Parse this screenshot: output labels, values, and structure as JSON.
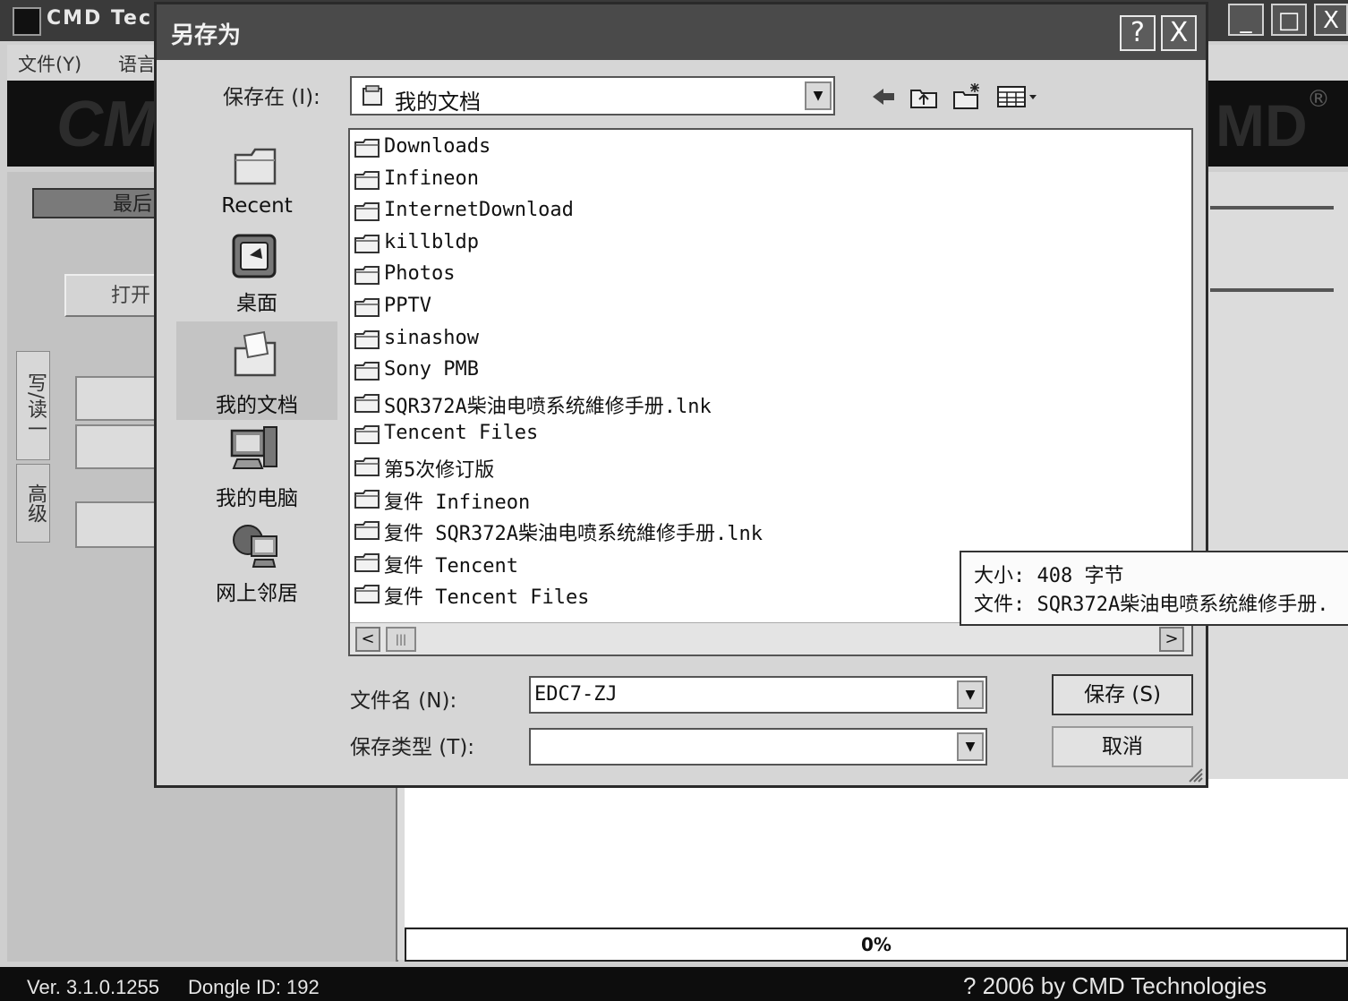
{
  "app": {
    "title": "CMD Tec",
    "menu": [
      "文件(Y)",
      "语言"
    ],
    "banner_left": "CM",
    "banner_right": "MD",
    "banner_reg": "®",
    "btn_recent": "最后",
    "btn_open": "打开",
    "side_tabs": [
      "写/读一",
      "高级"
    ],
    "progress": "0%",
    "status": {
      "version": "Ver. 3.1.0.1255",
      "dongle": "Dongle ID: 192",
      "copyright": "? 2006 by CMD Technologies"
    },
    "window_buttons": [
      "_",
      "□",
      "X"
    ]
  },
  "dialog": {
    "title": "另存为",
    "help_button": "?",
    "close_button": "X",
    "save_in_label": "保存在 (I):",
    "save_in_value": "我的文档",
    "toolbar_icons": [
      "back-icon",
      "up-folder-icon",
      "new-folder-icon",
      "view-menu-icon"
    ],
    "places": [
      {
        "label": "Recent",
        "icon": "recent-folder-icon"
      },
      {
        "label": "桌面",
        "icon": "desktop-icon"
      },
      {
        "label": "我的文档",
        "icon": "my-documents-icon"
      },
      {
        "label": "我的电脑",
        "icon": "my-computer-icon"
      },
      {
        "label": "网上邻居",
        "icon": "network-icon"
      }
    ],
    "files": [
      "Downloads",
      "Infineon",
      "InternetDownload",
      "killbldp",
      "Photos",
      "PPTV",
      "sinashow",
      "Sony PMB",
      "SQR372A柴油电喷系统維修手册.lnk",
      "Tencent Files",
      "第5次修订版",
      "复件 Infineon",
      "复件 SQR372A柴油电喷系统維修手册.lnk",
      "复件 Tencent",
      "复件 Tencent Files"
    ],
    "scroll_left": "<",
    "scroll_right": ">",
    "scroll_thumb": "|||",
    "filename_label": "文件名 (N):",
    "filename_value": "EDC7-ZJ",
    "filetype_label": "保存类型 (T):",
    "filetype_value": "",
    "save_button": "保存 (S)",
    "cancel_button": "取消",
    "tooltip": {
      "size_line": "大小: 408 字节",
      "file_line": "文件: SQR372A柴油电喷系统維修手册."
    }
  },
  "colors": {
    "titlebar": "#4a4a4a",
    "dialog_bg": "#d6d6d6",
    "banner": "#101010"
  }
}
